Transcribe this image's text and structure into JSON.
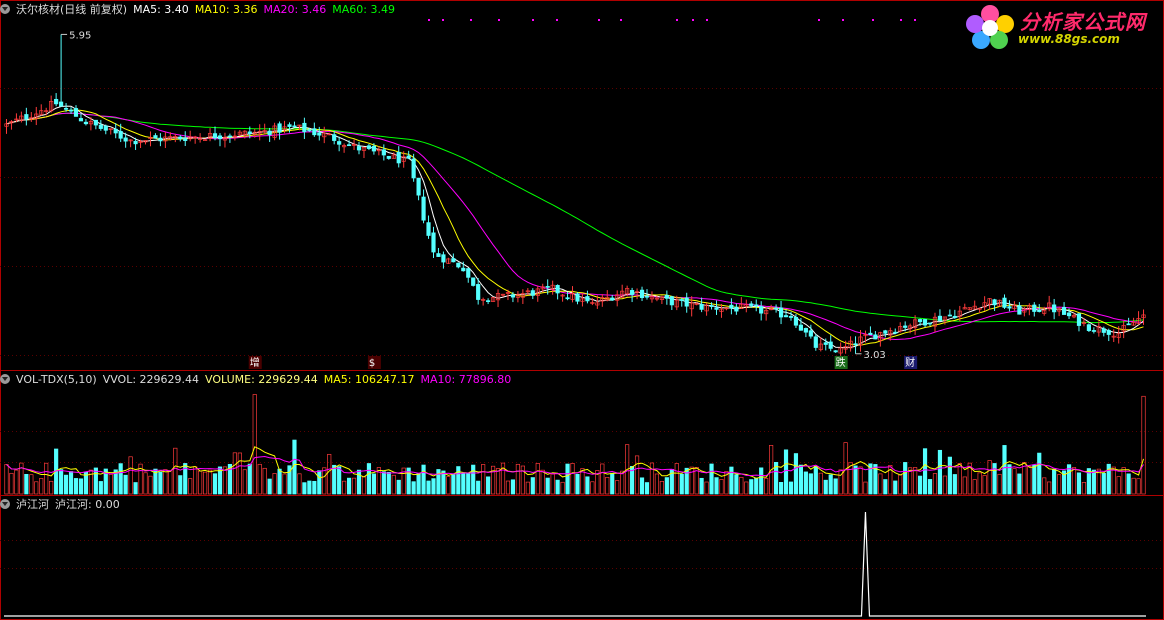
{
  "main_header": {
    "title": "沃尔核材(日线 前复权)",
    "ma5": "MA5: 3.40",
    "ma10": "MA10: 3.36",
    "ma20": "MA20: 3.46",
    "ma60": "MA60: 3.49"
  },
  "vol_header": {
    "name": "VOL-TDX(5,10)",
    "vvol": "VVOL: 229629.44",
    "volume": "VOLUME: 229629.44",
    "ma5": "MA5: 106247.17",
    "ma10": "MA10: 77896.80"
  },
  "ind_header": {
    "name": "泸江河",
    "value": "泸江河: 0.00"
  },
  "logo": {
    "title": "分析家公式网",
    "url": "www.88gs.com"
  },
  "colors": {
    "up": "#ff3b3b",
    "down": "#54ffff",
    "ma5": "#ffffff",
    "ma10": "#ffff00",
    "ma20": "#ff00ff",
    "ma60": "#00ff00",
    "border": "#b00000"
  },
  "chart_data": [
    {
      "type": "candlestick",
      "series": [
        {
          "name": "MA5",
          "color": "#ffffff"
        },
        {
          "name": "MA10",
          "color": "#ffff00"
        },
        {
          "name": "MA20",
          "color": "#ff00ff"
        },
        {
          "name": "MA60",
          "color": "#00ff00"
        }
      ],
      "annotations": [
        {
          "text": "5.95",
          "kind": "high",
          "x_index": 11,
          "value": 5.95
        },
        {
          "text": "3.03",
          "kind": "low",
          "x_index": 171,
          "value": 3.03
        },
        {
          "text": "增",
          "kind": "marker",
          "x_index": 50
        },
        {
          "text": "$",
          "kind": "marker",
          "x_index": 74
        },
        {
          "text": "跌",
          "kind": "marker",
          "x_index": 168
        },
        {
          "text": "财",
          "kind": "marker",
          "x_index": 182
        }
      ],
      "ylim": [
        2.9,
        6.1
      ],
      "grid": true
    },
    {
      "type": "bar",
      "title": "VOL-TDX(5,10)",
      "last_volume": 229629.44,
      "ma5": 106247.17,
      "ma10": 77896.8
    },
    {
      "type": "line",
      "title": "泸江河",
      "last_value": 0.0,
      "spikes_at_index": [
        173
      ]
    }
  ]
}
